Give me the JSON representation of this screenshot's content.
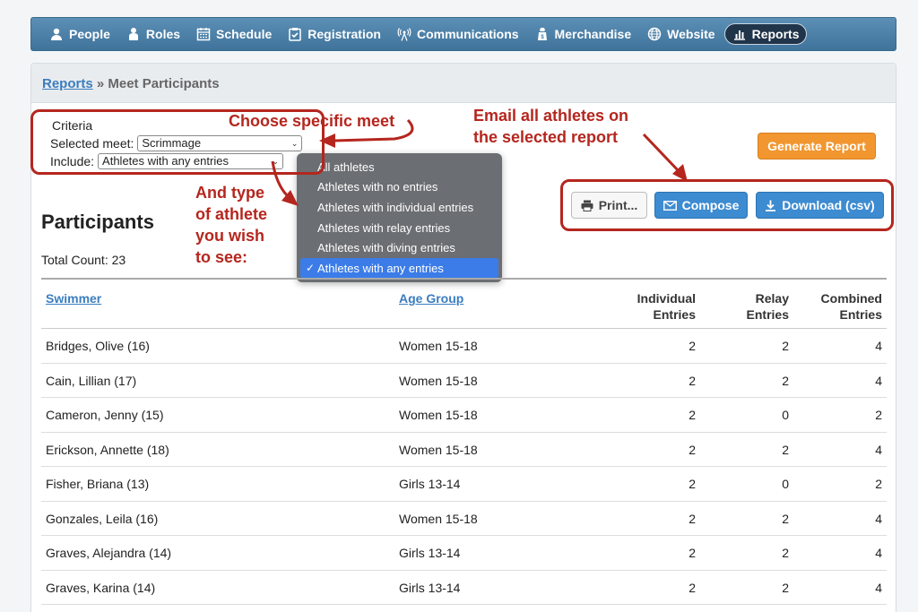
{
  "nav": {
    "items": [
      {
        "label": "People",
        "icon": "person-icon"
      },
      {
        "label": "Roles",
        "icon": "roles-icon"
      },
      {
        "label": "Schedule",
        "icon": "calendar-icon"
      },
      {
        "label": "Registration",
        "icon": "clipboard-icon"
      },
      {
        "label": "Communications",
        "icon": "broadcast-icon"
      },
      {
        "label": "Merchandise",
        "icon": "bag-icon"
      },
      {
        "label": "Website",
        "icon": "globe-icon"
      },
      {
        "label": "Reports",
        "icon": "bar-chart-icon",
        "active": true
      }
    ]
  },
  "breadcrumb": {
    "link": "Reports",
    "separator": "»",
    "current": "Meet Participants"
  },
  "criteria": {
    "title": "Criteria",
    "meet_label": "Selected meet:",
    "meet_value": "Scrimmage",
    "include_label": "Include:",
    "include_value": "Athletes with any entries"
  },
  "include_options": [
    "All athletes",
    "Athletes with no entries",
    "Athletes with individual entries",
    "Athletes with relay entries",
    "Athletes with diving entries",
    "Athletes with any entries"
  ],
  "buttons": {
    "generate": "Generate Report",
    "print": "Print...",
    "compose": "Compose",
    "download": "Download (csv)"
  },
  "participants": {
    "title": "Participants",
    "total_count": "Total Count: 23"
  },
  "table": {
    "headers": {
      "swimmer": "Swimmer",
      "age_group": "Age Group",
      "individual_1": "Individual",
      "individual_2": "Entries",
      "relay_1": "Relay",
      "relay_2": "Entries",
      "combined_1": "Combined",
      "combined_2": "Entries"
    },
    "rows": [
      {
        "name": "Bridges, Olive (16)",
        "age_group": "Women 15-18",
        "individual": "2",
        "relay": "2",
        "combined": "4"
      },
      {
        "name": "Cain, Lillian (17)",
        "age_group": "Women 15-18",
        "individual": "2",
        "relay": "2",
        "combined": "4"
      },
      {
        "name": "Cameron, Jenny (15)",
        "age_group": "Women 15-18",
        "individual": "2",
        "relay": "0",
        "combined": "2"
      },
      {
        "name": "Erickson, Annette (18)",
        "age_group": "Women 15-18",
        "individual": "2",
        "relay": "2",
        "combined": "4"
      },
      {
        "name": "Fisher, Briana (13)",
        "age_group": "Girls 13-14",
        "individual": "2",
        "relay": "0",
        "combined": "2"
      },
      {
        "name": "Gonzales, Leila (16)",
        "age_group": "Women 15-18",
        "individual": "2",
        "relay": "2",
        "combined": "4"
      },
      {
        "name": "Graves, Alejandra (14)",
        "age_group": "Girls 13-14",
        "individual": "2",
        "relay": "2",
        "combined": "4"
      },
      {
        "name": "Graves, Karina (14)",
        "age_group": "Girls 13-14",
        "individual": "2",
        "relay": "2",
        "combined": "4"
      }
    ]
  },
  "annotations": {
    "choose_meet": "Choose specific meet",
    "email_line1": "Email all athletes on",
    "email_line2": "the selected report",
    "type_line1": "And type",
    "type_line2": "of athlete",
    "type_line3": "you wish",
    "type_line4": "to see:"
  },
  "colors": {
    "annotation": "#b5261e",
    "nav": "#4a7fa8",
    "accent_button": "#3d8bd0",
    "generate_button": "#f2962f"
  }
}
